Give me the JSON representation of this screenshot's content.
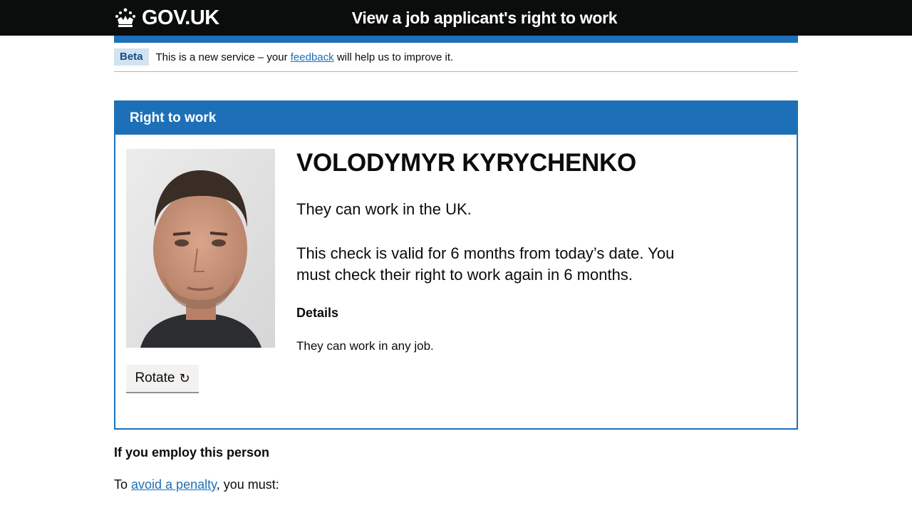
{
  "header": {
    "logo_text": "GOV.UK",
    "service_name": "View a job applicant's right to work"
  },
  "phase_banner": {
    "tag": "Beta",
    "text_before": "This is a new service – your ",
    "link_text": "feedback",
    "text_after": " will help us to improve it."
  },
  "panel": {
    "title": "Right to work",
    "name": "VOLODYMYR KYRYCHENKO",
    "status": "They can work in the UK.",
    "validity": "This check is valid for 6 months from today’s date. You must check their right to work again in 6 months.",
    "details_heading": "Details",
    "details_text": "They can work in any job.",
    "rotate_label": "Rotate",
    "rotate_icon": "↻"
  },
  "employ": {
    "heading": "If you employ this person",
    "penalty_before": "To ",
    "penalty_link": "avoid a penalty",
    "penalty_after": ", you must:"
  },
  "colors": {
    "header_bg": "#0b0c0c",
    "brand_blue": "#1d70b8",
    "tag_bg": "#d2e2f1",
    "link": "#1d70b8"
  }
}
